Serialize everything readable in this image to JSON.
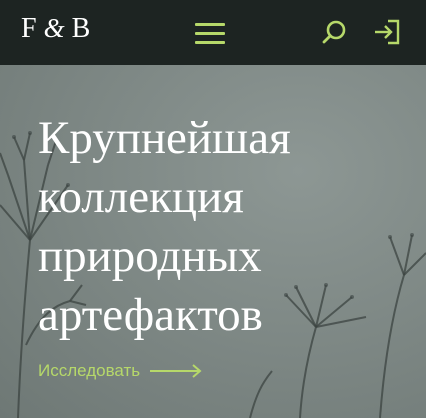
{
  "header": {
    "logo_left": "F",
    "logo_amp": "&",
    "logo_right": "B",
    "menu_icon": "hamburger-icon",
    "search_icon": "search-icon",
    "login_icon": "login-icon",
    "accent_color": "#b6d86a",
    "background_color": "#1d2422"
  },
  "hero": {
    "title_lines": [
      "Крупнейшая",
      "коллекция",
      "природных",
      "артефактов"
    ],
    "cta_label": "Исследовать",
    "cta_icon": "arrow-right-icon",
    "background_color": "#7b8582"
  }
}
